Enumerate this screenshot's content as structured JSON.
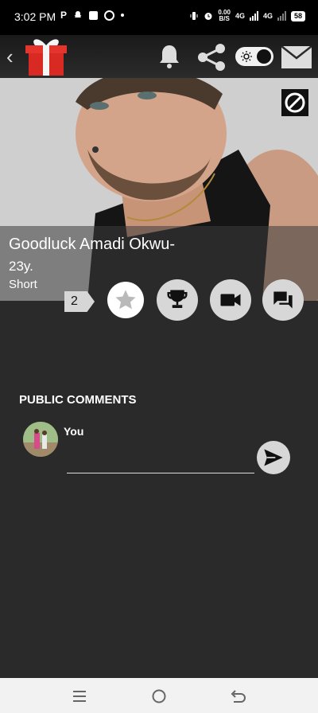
{
  "status_bar": {
    "time": "3:02 PM",
    "left_glyph_p": "P",
    "speed_value": "0.00",
    "speed_unit": "B/S",
    "network_1": "4G",
    "network_2": "4G",
    "battery": "58"
  },
  "app_bar": {
    "icons": [
      "back-chevron-icon",
      "gift-icon",
      "bell-icon",
      "share-icon",
      "theme-toggle",
      "mail-icon"
    ]
  },
  "profile": {
    "name": "Goodluck Amadi Okwu-",
    "age": "23y.",
    "type": "Short"
  },
  "actions": {
    "count": "2",
    "buttons": [
      "star-icon",
      "trophy-icon",
      "video-icon",
      "chat-icon"
    ]
  },
  "comments": {
    "title": "PUBLIC COMMENTS",
    "user_label": "You",
    "input_value": "",
    "input_placeholder": ""
  },
  "colors": {
    "background": "#2a2a2a",
    "gift_red": "#e5342b",
    "button_gray": "#d7d7d7"
  }
}
